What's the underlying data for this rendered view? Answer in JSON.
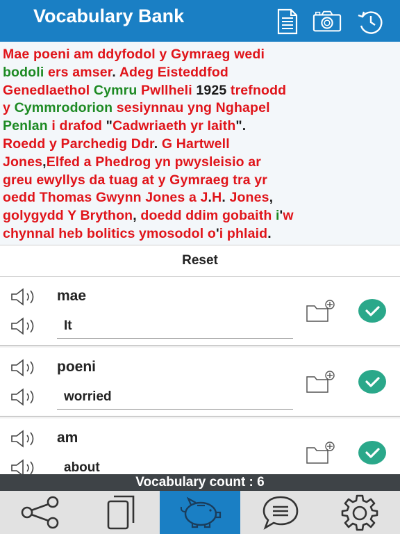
{
  "header": {
    "title": "Vocabulary Bank",
    "icons": [
      "document-icon",
      "camera-icon",
      "history-icon"
    ]
  },
  "passage": {
    "lines": [
      [
        {
          "t": "Mae poeni am ddyfodol y Gymraeg wedi",
          "c": "red"
        }
      ],
      [
        {
          "t": "bodoli ",
          "c": "green"
        },
        {
          "t": "ers amser",
          "c": "red"
        },
        {
          "t": ". ",
          "c": "black"
        },
        {
          "t": "Adeg Eisteddfod",
          "c": "red"
        }
      ],
      [
        {
          "t": "Genedlaethol ",
          "c": "red"
        },
        {
          "t": "Cymru ",
          "c": "green"
        },
        {
          "t": "Pwllheli ",
          "c": "red"
        },
        {
          "t": "1925 ",
          "c": "black"
        },
        {
          "t": "trefnodd",
          "c": "red"
        }
      ],
      [
        {
          "t": "y ",
          "c": "red"
        },
        {
          "t": "Cymmrodorion ",
          "c": "green"
        },
        {
          "t": "sesiynnau yng Nghapel",
          "c": "red"
        }
      ],
      [
        {
          "t": "Penlan ",
          "c": "green"
        },
        {
          "t": "i drafod ",
          "c": "red"
        },
        {
          "t": "\"",
          "c": "black"
        },
        {
          "t": "Cadwriaeth yr Iaith",
          "c": "red"
        },
        {
          "t": "\".",
          "c": "black"
        }
      ],
      [
        {
          "t": "Roedd y Parchedig Ddr",
          "c": "red"
        },
        {
          "t": ". ",
          "c": "black"
        },
        {
          "t": "G Hartwell",
          "c": "red"
        }
      ],
      [
        {
          "t": "Jones",
          "c": "red"
        },
        {
          "t": ",",
          "c": "black"
        },
        {
          "t": "Elfed a Phedrog yn pwysleisio ar",
          "c": "red"
        }
      ],
      [
        {
          "t": "greu ewyllys da tuag at y Gymraeg tra yr",
          "c": "red"
        }
      ],
      [
        {
          "t": "oedd Thomas Gwynn Jones a J",
          "c": "red"
        },
        {
          "t": ".",
          "c": "black"
        },
        {
          "t": "H",
          "c": "red"
        },
        {
          "t": ". ",
          "c": "black"
        },
        {
          "t": "Jones",
          "c": "red"
        },
        {
          "t": ",",
          "c": "black"
        }
      ],
      [
        {
          "t": "golygydd Y Brython",
          "c": "red"
        },
        {
          "t": ", ",
          "c": "black"
        },
        {
          "t": "doedd ddim gobaith ",
          "c": "red"
        },
        {
          "t": "i",
          "c": "green"
        },
        {
          "t": "'",
          "c": "black"
        },
        {
          "t": "w",
          "c": "red"
        }
      ],
      [
        {
          "t": "chynnal heb bolitics ymosodol o",
          "c": "red"
        },
        {
          "t": "'",
          "c": "black"
        },
        {
          "t": "i phlaid",
          "c": "red"
        },
        {
          "t": ".",
          "c": "black"
        }
      ]
    ]
  },
  "reset_label": "Reset",
  "words": [
    {
      "word": "mae",
      "meaning": "It"
    },
    {
      "word": "poeni",
      "meaning": "worried"
    },
    {
      "word": "am",
      "meaning": "about"
    }
  ],
  "footer": {
    "count_text": "Vocabulary count : 6"
  },
  "tabbar": {
    "tabs": [
      "share-icon",
      "flashcards-icon",
      "piggy-bank-icon",
      "chat-icon",
      "settings-icon"
    ],
    "active_index": 2
  },
  "colors": {
    "primary": "#1a7fc4",
    "accent_check": "#2aa88a",
    "text_red": "#e0141a",
    "text_green": "#1d8a23"
  }
}
